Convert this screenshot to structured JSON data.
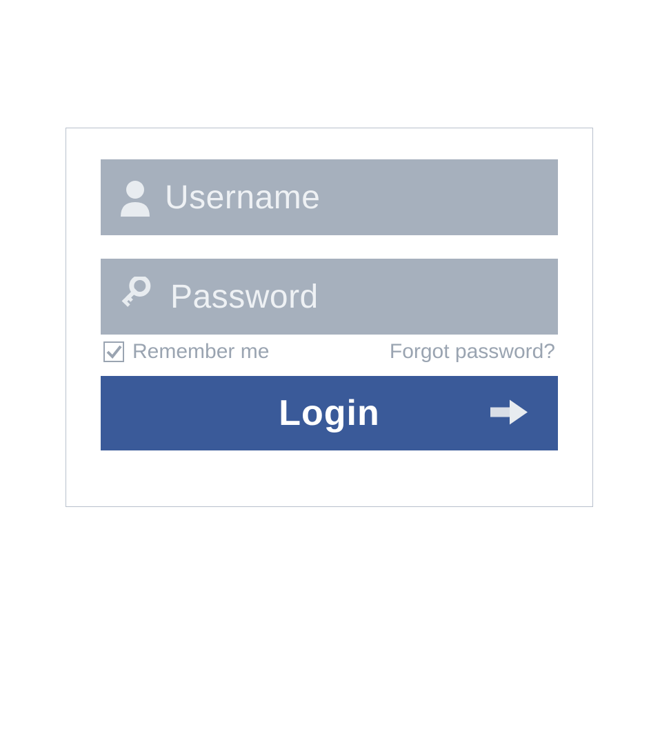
{
  "login": {
    "username_placeholder": "Username",
    "password_placeholder": "Password",
    "remember_label": "Remember me",
    "forgot_label": "Forgot password?",
    "submit_label": "Login",
    "remember_checked": true
  },
  "colors": {
    "field_bg": "#a6b0bd",
    "button_bg": "#3a5a99",
    "muted_text": "#9aa4b1"
  }
}
